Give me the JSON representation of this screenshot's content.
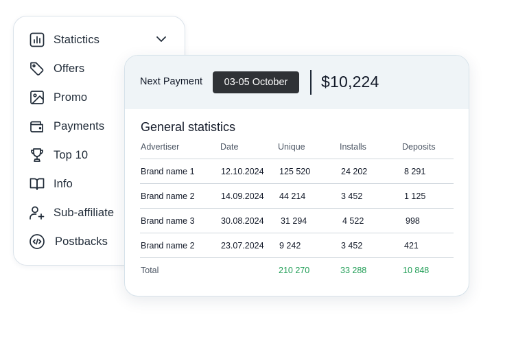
{
  "menu": {
    "items": [
      {
        "label": "Statictics",
        "icon": "bar-chart-icon"
      },
      {
        "label": "Offers",
        "icon": "tag-icon"
      },
      {
        "label": "Promo",
        "icon": "image-icon"
      },
      {
        "label": "Payments",
        "icon": "wallet-icon"
      },
      {
        "label": "Top 10",
        "icon": "trophy-icon"
      },
      {
        "label": "Info",
        "icon": "book-icon"
      },
      {
        "label": "Sub-affiliate",
        "icon": "user-plus-icon"
      },
      {
        "label": "Postbacks",
        "icon": "code-icon"
      }
    ],
    "expand_icon": "chevron-down-icon"
  },
  "payment": {
    "label": "Next Payment",
    "date": "03-05 October",
    "amount": "$10,224"
  },
  "stats": {
    "title": "General statistics",
    "columns": [
      "Advertiser",
      "Date",
      "Unique",
      "Installs",
      "Deposits"
    ],
    "rows": [
      {
        "advertiser": "Brand name 1",
        "date": "12.10.2024",
        "unique": "125 520",
        "installs": "24 202",
        "deposits": "8 291"
      },
      {
        "advertiser": "Brand name 2",
        "date": "14.09.2024",
        "unique": "44 214",
        "installs": "3 452",
        "deposits": "1 125"
      },
      {
        "advertiser": "Brand name 3",
        "date": "30.08.2024",
        "unique": "31 294",
        "installs": "4 522",
        "deposits": "998"
      },
      {
        "advertiser": "Brand name 2",
        "date": "23.07.2024",
        "unique": "9 242",
        "installs": "3 452",
        "deposits": "421"
      }
    ],
    "total": {
      "label": "Total",
      "unique": "210 270",
      "installs": "33 288",
      "deposits": "10 848"
    }
  },
  "colors": {
    "total_values": "#1f9d55",
    "badge_bg": "#2f3236",
    "header_bg": "#eff4f7",
    "icon_stroke": "#1f2a37"
  }
}
